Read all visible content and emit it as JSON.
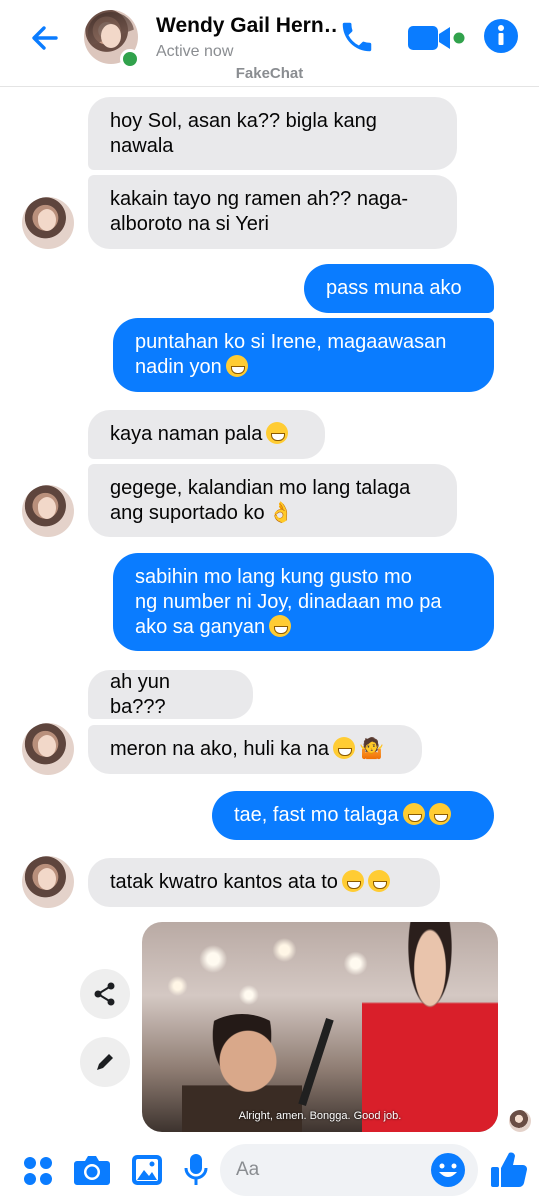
{
  "header": {
    "contact_name": "Wendy Gail Hern…",
    "status": "Active now",
    "app_label": "FakeChat",
    "icons": [
      "back-arrow-icon",
      "phone-icon",
      "video-camera-icon",
      "info-icon"
    ]
  },
  "messages": [
    {
      "from": "them",
      "text": "hoy Sol, asan ka?? bigla kang\nnawala"
    },
    {
      "from": "them",
      "text": "kakain tayo ng ramen ah?? naga-\nalboroto na si Yeri"
    },
    {
      "from": "me",
      "text": "pass muna ako"
    },
    {
      "from": "me",
      "text": "puntahan ko si Irene, magaawasan\nnadin yon"
    },
    {
      "from": "them",
      "text": "kaya naman pala"
    },
    {
      "from": "them",
      "text": "gegege, kalandian mo lang talaga\nang suportado ko"
    },
    {
      "from": "me",
      "text": "sabihin mo lang kung gusto mo\nng number ni Joy, dinadaan mo pa\nako sa ganyan"
    },
    {
      "from": "them",
      "text": "ah yun ba???"
    },
    {
      "from": "them",
      "text": "meron na ako, huli ka na"
    },
    {
      "from": "me",
      "text": "tae, fast mo talaga"
    },
    {
      "from": "them",
      "text": "tatak kwatro kantos ata to"
    }
  ],
  "photo": {
    "caption": "Alright, amen. Bongga. Good job.",
    "actions": [
      "share-icon",
      "edit-icon"
    ]
  },
  "composer": {
    "placeholder": "Aa",
    "icons": [
      "apps-icon",
      "camera-icon",
      "gallery-icon",
      "microphone-icon",
      "emoji-icon",
      "thumbs-up-icon"
    ]
  },
  "colors": {
    "accent": "#0a7cff",
    "incoming_bubble": "#e9e9eb",
    "online": "#31a24c"
  }
}
